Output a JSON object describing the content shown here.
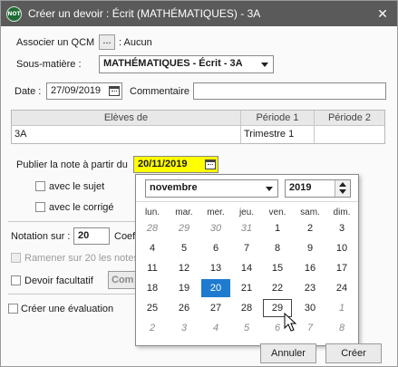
{
  "window": {
    "logo_text": "NOT",
    "title": "Créer un devoir : Écrit (MATHÉMATIQUES) - 3A",
    "close_glyph": "✕"
  },
  "qcm": {
    "label": "Associer un QCM",
    "button": "...",
    "value": ": Aucun"
  },
  "sous_matiere": {
    "label": "Sous-matière :",
    "value": "MATHÉMATIQUES - Écrit - 3A"
  },
  "date": {
    "label": "Date :",
    "value": "27/09/2019"
  },
  "commentaire": {
    "label": "Commentaire :",
    "value": ""
  },
  "table": {
    "headers": [
      "Elèves de",
      "Période 1",
      "Période 2"
    ],
    "row": [
      "3A",
      "Trimestre 1",
      ""
    ]
  },
  "publish": {
    "label": "Publier la note à partir du",
    "value": "20/11/2019"
  },
  "options": {
    "avec_sujet": "avec le sujet",
    "avec_corrige": "avec le corrigé",
    "notation_label": "Notation sur :",
    "notation_value": "20",
    "coef_label": "Coef",
    "ramener": "Ramener sur 20 les notes",
    "devoir_facultatif": "Devoir facultatif",
    "com_button": "Com",
    "creer_evaluation": "Créer une évaluation"
  },
  "calendar": {
    "month": "novembre",
    "year": "2019",
    "weekdays": [
      "lun.",
      "mar.",
      "mer.",
      "jeu.",
      "ven.",
      "sam.",
      "dim."
    ],
    "weeks": [
      [
        "28",
        "29",
        "30",
        "31",
        "1",
        "2",
        "3"
      ],
      [
        "4",
        "5",
        "6",
        "7",
        "8",
        "9",
        "10"
      ],
      [
        "11",
        "12",
        "13",
        "14",
        "15",
        "16",
        "17"
      ],
      [
        "18",
        "19",
        "20",
        "21",
        "22",
        "23",
        "24"
      ],
      [
        "25",
        "26",
        "27",
        "28",
        "29",
        "30",
        "1"
      ],
      [
        "2",
        "3",
        "4",
        "5",
        "6",
        "7",
        "8"
      ]
    ],
    "selected_day": "20",
    "today_day": "29",
    "selected_color": "#1e7bd0"
  },
  "footer": {
    "cancel": "Annuler",
    "create": "Créer"
  },
  "icons": {
    "calendar": "calendar-icon",
    "spin": "spinner-arrows-icon",
    "cursor": "mouse-pointer-icon"
  }
}
